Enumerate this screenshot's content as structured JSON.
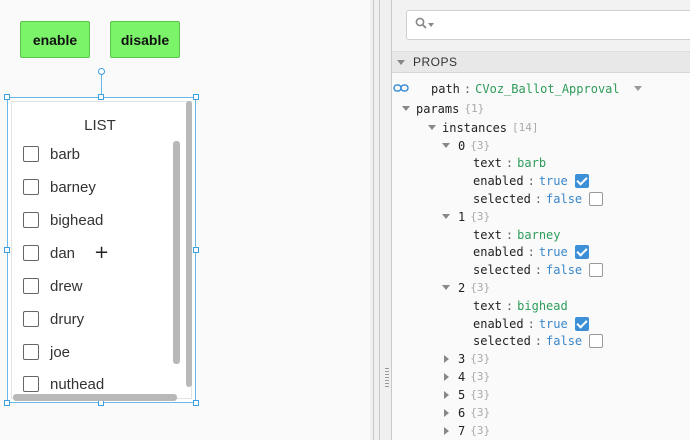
{
  "canvas": {
    "enable_label": "enable",
    "disable_label": "disable",
    "list": {
      "title": "LIST",
      "items": [
        "barb",
        "barney",
        "bighead",
        "dan",
        "drew",
        "drury",
        "joe",
        "nuthead"
      ],
      "cursor_glyph": "+"
    }
  },
  "props": {
    "search": {
      "placeholder": ""
    },
    "section_title": "PROPS",
    "path": {
      "key": "path",
      "value": "CVoz_Ballot_Approval"
    },
    "params": {
      "key": "params",
      "count": "{1}"
    },
    "instances": {
      "key": "instances",
      "count": "[14]"
    },
    "expanded": [
      {
        "index": "0",
        "count": "{3}",
        "text": "barb",
        "enabled": "true",
        "selected": "false"
      },
      {
        "index": "1",
        "count": "{3}",
        "text": "barney",
        "enabled": "true",
        "selected": "false"
      },
      {
        "index": "2",
        "count": "{3}",
        "text": "bighead",
        "enabled": "true",
        "selected": "false"
      }
    ],
    "collapsed": [
      {
        "index": "3",
        "count": "{3}"
      },
      {
        "index": "4",
        "count": "{3}"
      },
      {
        "index": "5",
        "count": "{3}"
      },
      {
        "index": "6",
        "count": "{3}"
      },
      {
        "index": "7",
        "count": "{3}"
      }
    ],
    "labels": {
      "text": "text",
      "enabled": "enabled",
      "selected": "selected",
      "sep": ":"
    }
  },
  "colors": {
    "accent": "#3d8fd8",
    "button_green": "#7bf46a",
    "string_value": "#2e9c5a",
    "bool_value": "#3a86c8"
  },
  "icons": [
    "search-icon",
    "link-icon",
    "plus-icon"
  ]
}
